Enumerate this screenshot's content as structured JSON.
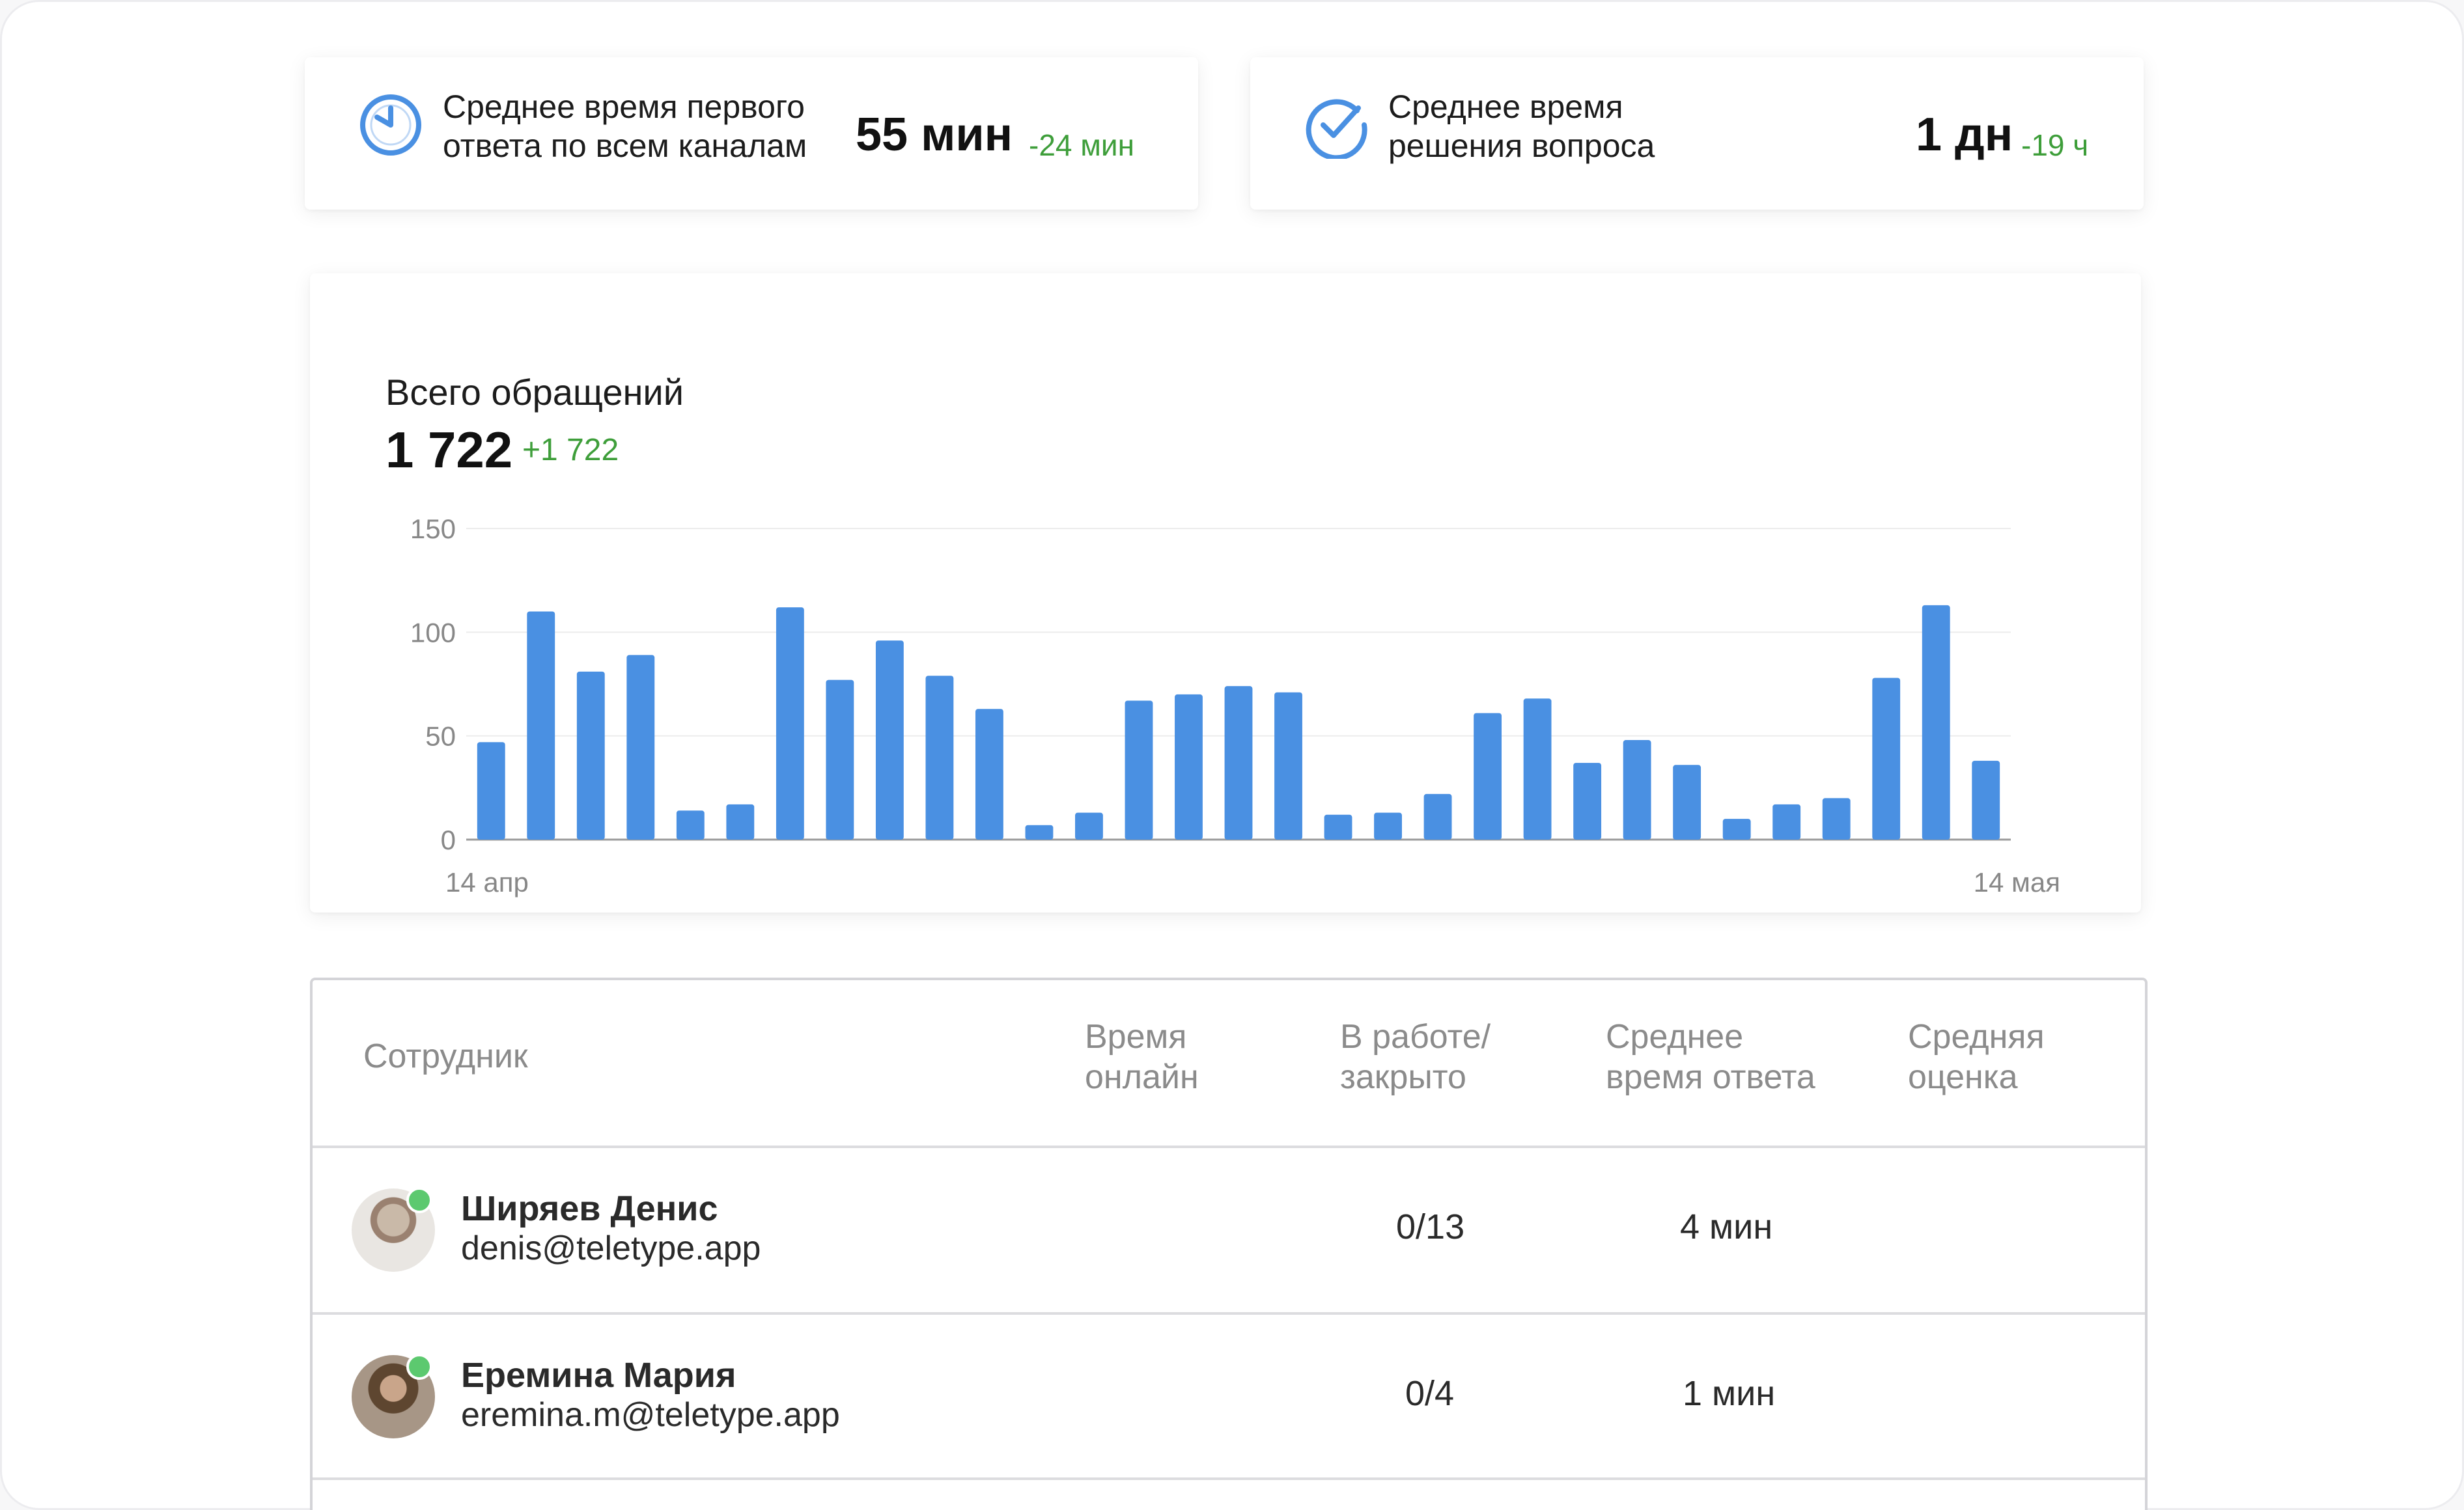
{
  "kpis": [
    {
      "label": "Среднее время первого\nответа по всем каналам",
      "value": "55 мин",
      "delta": "-24 мин",
      "icon": "clock-icon"
    },
    {
      "label": "Среднее время\nрешения вопроса",
      "value": "1 дн",
      "delta": "-19 ч",
      "icon": "check-circle-icon"
    }
  ],
  "colors": {
    "accent": "#4a90e2",
    "positive": "#3e9e3a",
    "online": "#5cc96f"
  },
  "chart": {
    "title": "Всего обращений",
    "total": "1 722",
    "delta": "+1 722"
  },
  "chart_data": {
    "type": "bar",
    "title": "Всего обращений",
    "xlabel": "",
    "ylabel": "",
    "ylim": [
      0,
      150
    ],
    "yticks": [
      0,
      50,
      100,
      150
    ],
    "x_labels": {
      "first": "14 апр",
      "last": "14 мая"
    },
    "values": [
      47,
      110,
      81,
      89,
      14,
      17,
      112,
      77,
      96,
      79,
      63,
      7,
      13,
      67,
      70,
      74,
      71,
      12,
      13,
      22,
      61,
      68,
      37,
      48,
      36,
      10,
      17,
      20,
      78,
      113,
      38
    ],
    "grid": true
  },
  "table": {
    "headers": [
      "Сотрудник",
      "Время\nонлайн",
      "В работе/\nзакрыто",
      "Среднее\nвремя ответа",
      "Средняя\nоценка"
    ],
    "rows": [
      {
        "name": "Ширяев Денис",
        "email": "denis@teletype.app",
        "online": "",
        "work": "0/13",
        "avg_time": "4 мин",
        "rating": ""
      },
      {
        "name": "Еремина Мария",
        "email": "eremina.m@teletype.app",
        "online": "",
        "work": "0/4",
        "avg_time": "1 мин",
        "rating": ""
      }
    ]
  }
}
